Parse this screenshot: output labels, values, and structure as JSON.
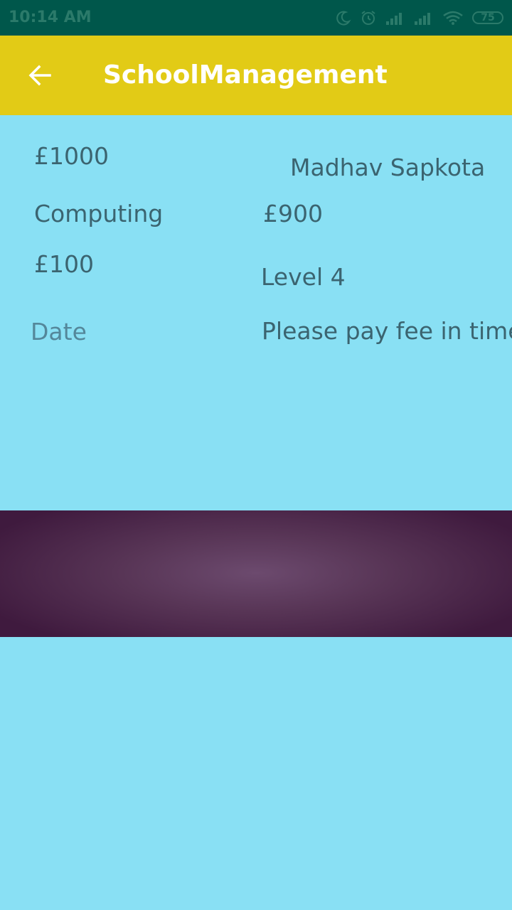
{
  "status_bar": {
    "time": "10:14 AM",
    "battery": "75",
    "icons": [
      "moon-icon",
      "alarm-icon",
      "signal-icon",
      "signal-icon",
      "wifi-icon",
      "battery-icon"
    ]
  },
  "app_bar": {
    "title": "SchoolManagement",
    "back_icon": "arrow-left-icon"
  },
  "details": {
    "amount_total": "£1000",
    "student_name": "Madhav Sapkota",
    "course": "Computing",
    "amount_paid": "£900",
    "amount_due": "£100",
    "level": "Level 4",
    "date_placeholder": "Date",
    "message": "Please pay fee in time"
  },
  "colors": {
    "status_bar": "#00574B",
    "app_bar": "#E2CB16",
    "background": "#89E0F4",
    "banner": "#583556",
    "text": "#3B6470"
  }
}
